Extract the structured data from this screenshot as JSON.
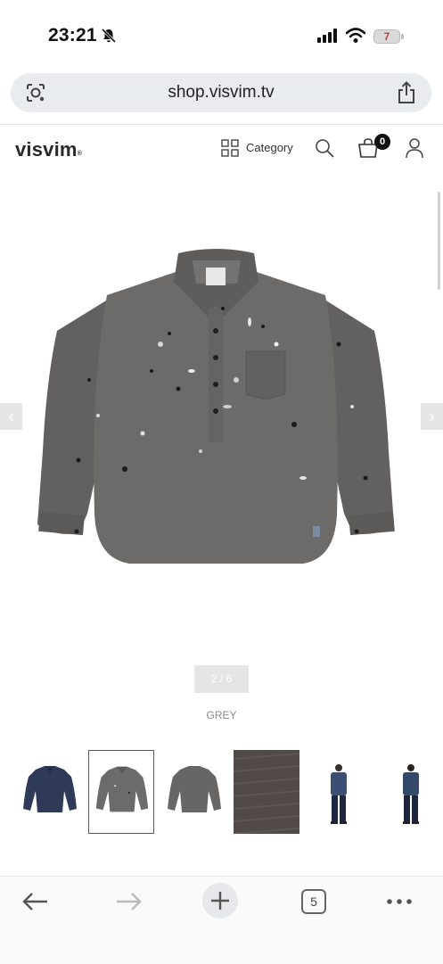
{
  "status_bar": {
    "time": "23:21",
    "battery": "7"
  },
  "browser": {
    "url": "shop.visvim.tv",
    "tab_count": "5"
  },
  "site_header": {
    "logo": "visvim",
    "logo_mark": "®",
    "category_label": "Category",
    "cart_count": "0"
  },
  "gallery": {
    "counter": "2 / 6",
    "color_name": "GREY",
    "current_index": 2,
    "total_images": 6
  },
  "thumbnails": [
    {
      "name": "navy-shirt-thumb",
      "selected": false
    },
    {
      "name": "grey-shirt-front-thumb",
      "selected": true
    },
    {
      "name": "grey-shirt-back-thumb",
      "selected": false
    },
    {
      "name": "fabric-texture-thumb",
      "selected": false
    },
    {
      "name": "model-front-thumb",
      "selected": false
    },
    {
      "name": "model-back-thumb",
      "selected": false
    }
  ],
  "colors": {
    "shirt_grey": "#6d6b69",
    "shirt_navy": "#2e3a58",
    "fabric": "#524a48",
    "battery_text": "#c23b3b"
  },
  "icons": [
    "bell-slash-icon",
    "signal-icon",
    "wifi-icon",
    "battery-icon",
    "lens-icon",
    "share-icon",
    "grid-icon",
    "search-icon",
    "cart-icon",
    "user-icon",
    "back-icon",
    "forward-icon",
    "new-tab-icon",
    "more-icon"
  ]
}
